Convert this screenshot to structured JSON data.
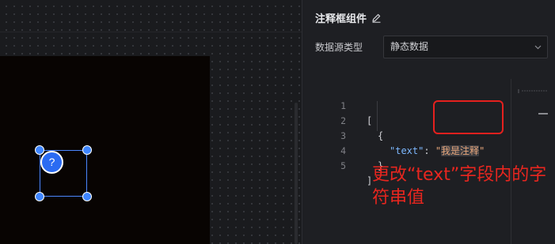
{
  "panel": {
    "title": "注释框组件",
    "datasource_label": "数据源类型",
    "datasource_value": "静态数据"
  },
  "editor": {
    "line_numbers": [
      "1",
      "2",
      "3",
      "4",
      "5"
    ],
    "line1": "[",
    "line2": "{",
    "line3_key": "\"text\"",
    "line3_colon": ": ",
    "line3_quote_open": "\"",
    "line3_value": "我是注释",
    "line3_quote_close": "\"",
    "line4": "}",
    "line5": "]"
  },
  "canvas": {
    "marker_symbol": "?"
  },
  "callout": {
    "text": "更改“text”字段内的字符串值"
  },
  "colors": {
    "accent": "#3f86ff",
    "callout": "#e5201e"
  },
  "icons": [
    "edit-icon",
    "chevron-down-icon",
    "help-icon"
  ]
}
